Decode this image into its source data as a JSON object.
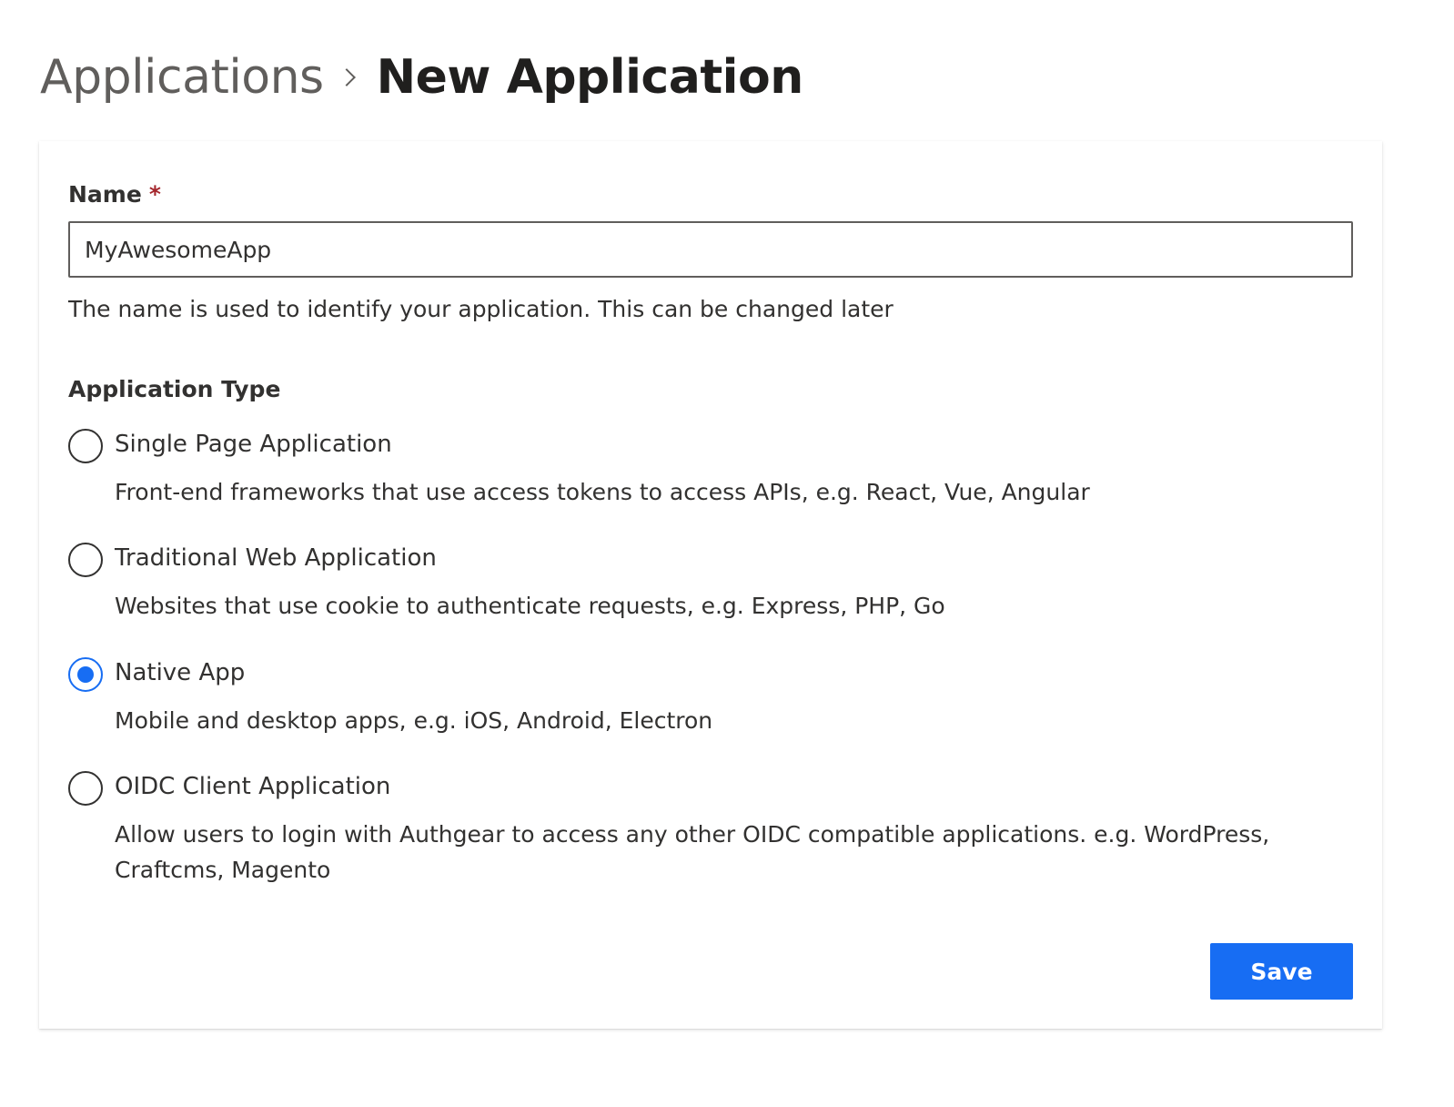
{
  "breadcrumb": {
    "parent": "Applications",
    "current": "New Application",
    "separator_icon": "chevron-right-icon"
  },
  "form": {
    "name_label": "Name",
    "required_marker": "*",
    "name_value": "MyAwesomeApp",
    "name_help": "The name is used to identify your application. This can be changed later",
    "type_label": "Application Type",
    "selected_type": "Native App",
    "options": [
      {
        "label": "Single Page Application",
        "description": "Front-end frameworks that use access tokens to access APIs, e.g. React, Vue, Angular",
        "checked": false
      },
      {
        "label": "Traditional Web Application",
        "description": "Websites that use cookie to authenticate requests, e.g. Express, PHP, Go",
        "checked": false
      },
      {
        "label": "Native App",
        "description": "Mobile and desktop apps, e.g. iOS, Android, Electron",
        "checked": true
      },
      {
        "label": "OIDC Client Application",
        "description": "Allow users to login with Authgear to access any other OIDC compatible applications. e.g. WordPress, Craftcms, Magento",
        "checked": false
      }
    ],
    "save_label": "Save"
  },
  "colors": {
    "accent": "#176df3",
    "required": "#a4262c",
    "text": "#323130"
  }
}
